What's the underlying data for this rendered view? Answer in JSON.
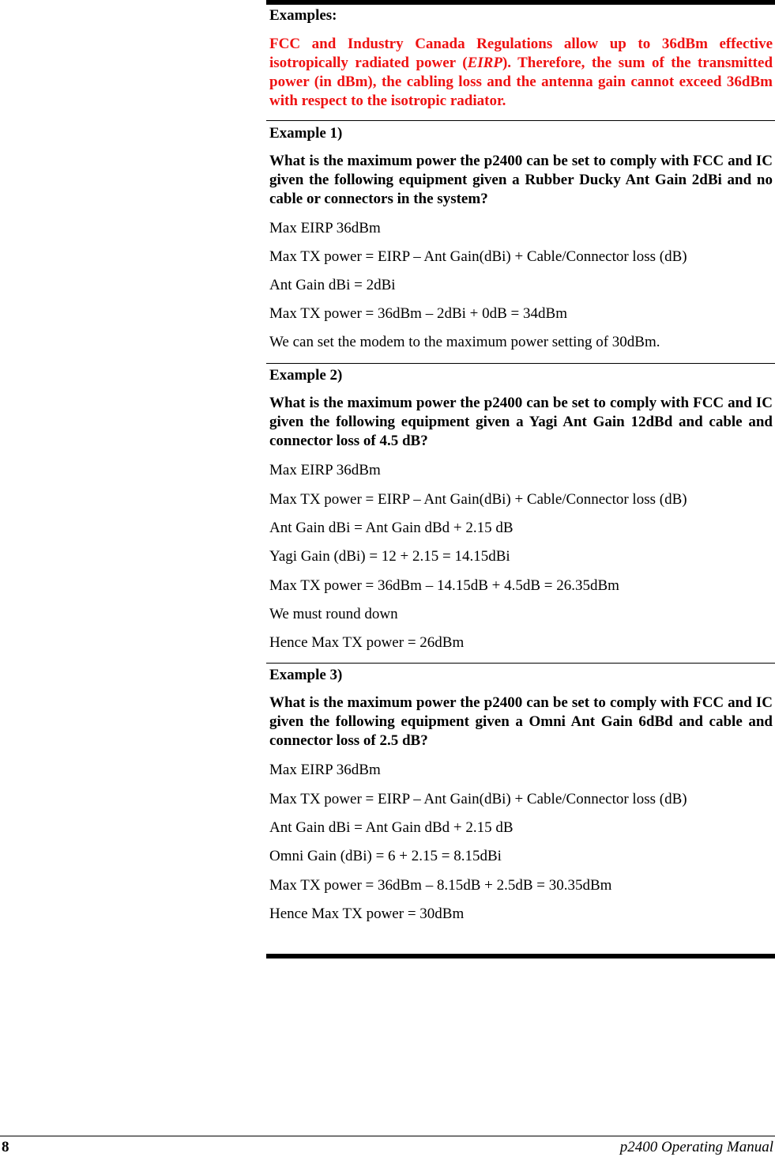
{
  "examples_heading": "Examples:",
  "intro": {
    "part1": "FCC and Industry Canada Regulations allow up to 36dBm effective isotropically radiated power (",
    "eirp": "EIRP",
    "part2": ").  Therefore, the sum of the transmitted power (in dBm), the cabling loss and the antenna gain cannot exceed 36dBm with respect to the isotropic radiator.",
    "color": "#ee1111"
  },
  "examples": [
    {
      "title": "Example 1)",
      "question": "What is the maximum power the p2400 can be set to comply with FCC and IC given the following equipment given a Rubber Ducky Ant Gain 2dBi and no cable or connectors in the system?",
      "lines": [
        "Max EIRP 36dBm",
        "Max TX power = EIRP – Ant Gain(dBi) + Cable/Connector loss (dB)",
        "Ant Gain dBi = 2dBi",
        "Max TX power = 36dBm  – 2dBi  + 0dB = 34dBm",
        "We can set the modem to the maximum power setting of 30dBm."
      ]
    },
    {
      "title": "Example 2)",
      "question": "What is the maximum power the p2400 can be set to comply with FCC and IC given the following equipment given a Yagi Ant Gain 12dBd and cable and connector loss of 4.5 dB?",
      "lines": [
        "Max EIRP 36dBm",
        "Max TX power = EIRP – Ant Gain(dBi) + Cable/Connector loss (dB)",
        "Ant Gain dBi = Ant Gain dBd + 2.15  dB",
        "Yagi Gain (dBi) = 12 + 2.15 = 14.15dBi",
        "Max TX power = 36dBm  – 14.15dB  + 4.5dB = 26.35dBm",
        "We must round down",
        "Hence Max TX power = 26dBm"
      ]
    },
    {
      "title": "Example 3)",
      "question": "What is the maximum power the p2400 can be set to comply with FCC and IC given the following equipment given a Omni Ant Gain 6dBd and cable and connector loss of 2.5 dB?",
      "lines": [
        "Max EIRP 36dBm",
        "Max TX power = EIRP – Ant Gain(dBi) + Cable/Connector loss (dB)",
        "Ant Gain dBi = Ant Gain dBd + 2.15  dB",
        "Omni Gain (dBi) = 6 + 2.15 = 8.15dBi",
        "Max TX power = 36dBm  – 8.15dB  + 2.5dB = 30.35dBm",
        "Hence Max TX power = 30dBm"
      ]
    }
  ],
  "footer": {
    "page_number": "8",
    "manual_title": "p2400 Operating Manual"
  }
}
